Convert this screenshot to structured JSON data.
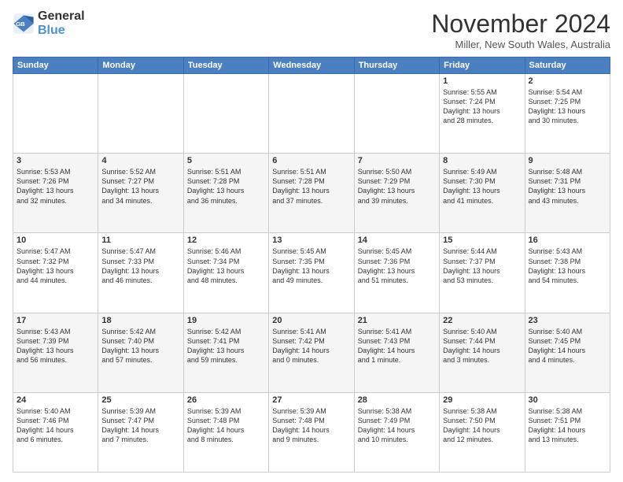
{
  "logo": {
    "line1": "General",
    "line2": "Blue"
  },
  "header": {
    "month": "November 2024",
    "location": "Miller, New South Wales, Australia"
  },
  "weekdays": [
    "Sunday",
    "Monday",
    "Tuesday",
    "Wednesday",
    "Thursday",
    "Friday",
    "Saturday"
  ],
  "weeks": [
    [
      {
        "day": "",
        "info": ""
      },
      {
        "day": "",
        "info": ""
      },
      {
        "day": "",
        "info": ""
      },
      {
        "day": "",
        "info": ""
      },
      {
        "day": "",
        "info": ""
      },
      {
        "day": "1",
        "info": "Sunrise: 5:55 AM\nSunset: 7:24 PM\nDaylight: 13 hours\nand 28 minutes."
      },
      {
        "day": "2",
        "info": "Sunrise: 5:54 AM\nSunset: 7:25 PM\nDaylight: 13 hours\nand 30 minutes."
      }
    ],
    [
      {
        "day": "3",
        "info": "Sunrise: 5:53 AM\nSunset: 7:26 PM\nDaylight: 13 hours\nand 32 minutes."
      },
      {
        "day": "4",
        "info": "Sunrise: 5:52 AM\nSunset: 7:27 PM\nDaylight: 13 hours\nand 34 minutes."
      },
      {
        "day": "5",
        "info": "Sunrise: 5:51 AM\nSunset: 7:28 PM\nDaylight: 13 hours\nand 36 minutes."
      },
      {
        "day": "6",
        "info": "Sunrise: 5:51 AM\nSunset: 7:28 PM\nDaylight: 13 hours\nand 37 minutes."
      },
      {
        "day": "7",
        "info": "Sunrise: 5:50 AM\nSunset: 7:29 PM\nDaylight: 13 hours\nand 39 minutes."
      },
      {
        "day": "8",
        "info": "Sunrise: 5:49 AM\nSunset: 7:30 PM\nDaylight: 13 hours\nand 41 minutes."
      },
      {
        "day": "9",
        "info": "Sunrise: 5:48 AM\nSunset: 7:31 PM\nDaylight: 13 hours\nand 43 minutes."
      }
    ],
    [
      {
        "day": "10",
        "info": "Sunrise: 5:47 AM\nSunset: 7:32 PM\nDaylight: 13 hours\nand 44 minutes."
      },
      {
        "day": "11",
        "info": "Sunrise: 5:47 AM\nSunset: 7:33 PM\nDaylight: 13 hours\nand 46 minutes."
      },
      {
        "day": "12",
        "info": "Sunrise: 5:46 AM\nSunset: 7:34 PM\nDaylight: 13 hours\nand 48 minutes."
      },
      {
        "day": "13",
        "info": "Sunrise: 5:45 AM\nSunset: 7:35 PM\nDaylight: 13 hours\nand 49 minutes."
      },
      {
        "day": "14",
        "info": "Sunrise: 5:45 AM\nSunset: 7:36 PM\nDaylight: 13 hours\nand 51 minutes."
      },
      {
        "day": "15",
        "info": "Sunrise: 5:44 AM\nSunset: 7:37 PM\nDaylight: 13 hours\nand 53 minutes."
      },
      {
        "day": "16",
        "info": "Sunrise: 5:43 AM\nSunset: 7:38 PM\nDaylight: 13 hours\nand 54 minutes."
      }
    ],
    [
      {
        "day": "17",
        "info": "Sunrise: 5:43 AM\nSunset: 7:39 PM\nDaylight: 13 hours\nand 56 minutes."
      },
      {
        "day": "18",
        "info": "Sunrise: 5:42 AM\nSunset: 7:40 PM\nDaylight: 13 hours\nand 57 minutes."
      },
      {
        "day": "19",
        "info": "Sunrise: 5:42 AM\nSunset: 7:41 PM\nDaylight: 13 hours\nand 59 minutes."
      },
      {
        "day": "20",
        "info": "Sunrise: 5:41 AM\nSunset: 7:42 PM\nDaylight: 14 hours\nand 0 minutes."
      },
      {
        "day": "21",
        "info": "Sunrise: 5:41 AM\nSunset: 7:43 PM\nDaylight: 14 hours\nand 1 minute."
      },
      {
        "day": "22",
        "info": "Sunrise: 5:40 AM\nSunset: 7:44 PM\nDaylight: 14 hours\nand 3 minutes."
      },
      {
        "day": "23",
        "info": "Sunrise: 5:40 AM\nSunset: 7:45 PM\nDaylight: 14 hours\nand 4 minutes."
      }
    ],
    [
      {
        "day": "24",
        "info": "Sunrise: 5:40 AM\nSunset: 7:46 PM\nDaylight: 14 hours\nand 6 minutes."
      },
      {
        "day": "25",
        "info": "Sunrise: 5:39 AM\nSunset: 7:47 PM\nDaylight: 14 hours\nand 7 minutes."
      },
      {
        "day": "26",
        "info": "Sunrise: 5:39 AM\nSunset: 7:48 PM\nDaylight: 14 hours\nand 8 minutes."
      },
      {
        "day": "27",
        "info": "Sunrise: 5:39 AM\nSunset: 7:48 PM\nDaylight: 14 hours\nand 9 minutes."
      },
      {
        "day": "28",
        "info": "Sunrise: 5:38 AM\nSunset: 7:49 PM\nDaylight: 14 hours\nand 10 minutes."
      },
      {
        "day": "29",
        "info": "Sunrise: 5:38 AM\nSunset: 7:50 PM\nDaylight: 14 hours\nand 12 minutes."
      },
      {
        "day": "30",
        "info": "Sunrise: 5:38 AM\nSunset: 7:51 PM\nDaylight: 14 hours\nand 13 minutes."
      }
    ]
  ]
}
